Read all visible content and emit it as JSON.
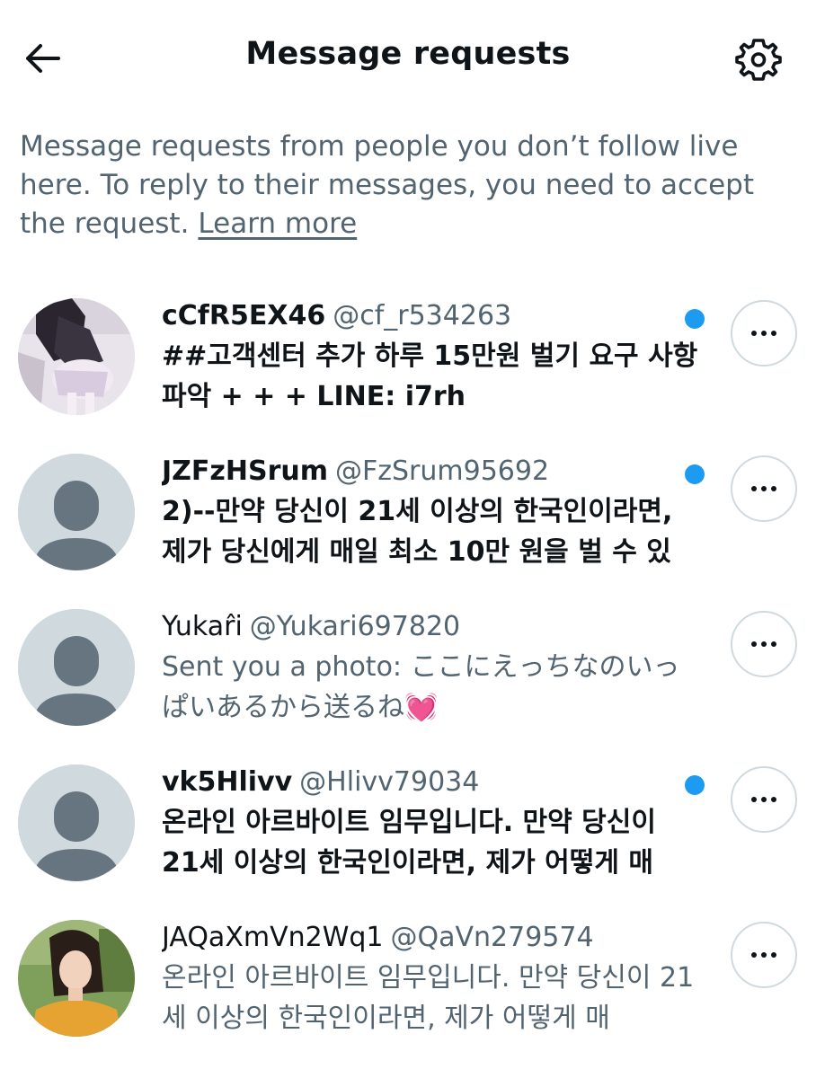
{
  "header": {
    "title": "Message requests",
    "back_icon": "arrow-left-icon",
    "settings_icon": "gear-icon"
  },
  "intro": {
    "text": "Message requests from people you don’t follow live here. To reply to their messages, you need to accept the request.",
    "learn_more": "Learn more"
  },
  "requests": [
    {
      "name": "cCfR5EX46",
      "handle": "@cf_r534263",
      "preview": "##고객센터 추가 하루 15만원 벌기 요구 사항 파악 + + + LINE: i7rh",
      "unread": true,
      "avatar": "photo"
    },
    {
      "name": "JZFzHSrum",
      "handle": "@FzSrum95692",
      "preview": "2)--만약 당신이 21세 이상의 한국인이라면, 제가 당신에게 매일 최소 10만 원을 벌 수 있",
      "unread": true,
      "avatar": "default"
    },
    {
      "name": "Yukar̂i",
      "handle": "@Yukari697820",
      "preview": "Sent you a photo: ここにえっちなのいっぱいあるから送るね💓",
      "unread": false,
      "avatar": "default"
    },
    {
      "name": "vk5Hlivv",
      "handle": "@Hlivv79034",
      "preview": "온라인 아르바이트 임무입니다. 만약 당신이 21세 이상의 한국인이라면, 제가 어떻게 매",
      "unread": true,
      "avatar": "default"
    },
    {
      "name": "JAQaXmVn2Wq1",
      "handle": "@QaVn279574",
      "preview": "온라인 아르바이트 임무입니다. 만약 당신이 21세 이상의 한국인이라면, 제가 어떻게 매",
      "unread": false,
      "avatar": "photo"
    }
  ],
  "colors": {
    "unread_dot": "#1d9bf0",
    "muted_text": "#536471",
    "primary_text": "#0f1419",
    "default_avatar_bg": "#cfd9de",
    "default_avatar_figure": "#66757f"
  },
  "more_icon": "more-horizontal-icon"
}
